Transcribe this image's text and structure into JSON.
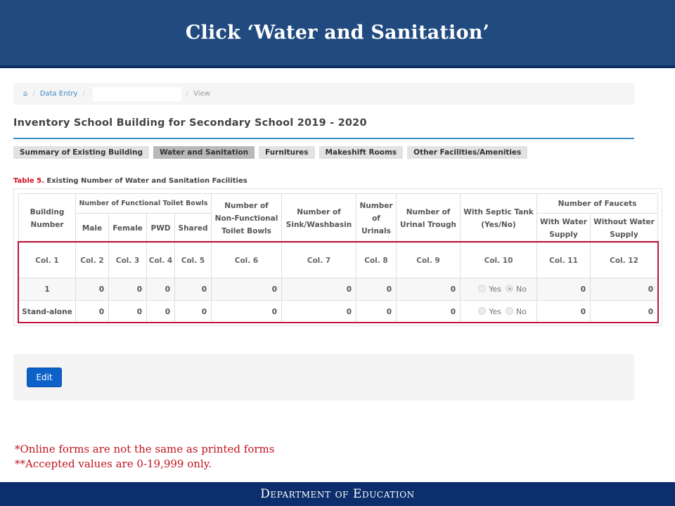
{
  "banner": {
    "title": "Click ‘Water and Sanitation’"
  },
  "breadcrumb": {
    "home_icon": "⌂",
    "separator": "/",
    "items": [
      "Data Entry",
      "",
      "View"
    ]
  },
  "page": {
    "title": "Inventory School Building for Secondary School 2019 - 2020"
  },
  "tabs": [
    {
      "label": "Summary of Existing Building",
      "active": false
    },
    {
      "label": "Water and Sanitation",
      "active": true
    },
    {
      "label": "Furnitures",
      "active": false
    },
    {
      "label": "Makeshift Rooms",
      "active": false
    },
    {
      "label": "Other Facilities/Amenities",
      "active": false
    }
  ],
  "table": {
    "caption_label": "Table 5.",
    "caption_text": "Existing Number of Water and Sanitation Facilities",
    "headers": {
      "building_number": "Building Number",
      "functional_toilets": "Number of Functional Toilet Bowls",
      "male": "Male",
      "female": "Female",
      "pwd": "PWD",
      "shared": "Shared",
      "non_functional": "Number of Non-Functional Toilet Bowls",
      "sink": "Number of Sink/Washbasin",
      "urinals": "Number of Urinals",
      "urinal_trough": "Number of Urinal Trough",
      "septic_tank": "With Septic Tank (Yes/No)",
      "faucets": "Number of Faucets",
      "with_water": "With Water Supply",
      "without_water": "Without Water Supply"
    },
    "col_numbers": [
      "Col. 1",
      "Col. 2",
      "Col. 3",
      "Col. 4",
      "Col. 5",
      "Col. 6",
      "Col. 7",
      "Col. 8",
      "Col. 9",
      "Col. 10",
      "Col. 11",
      "Col. 12"
    ],
    "radio_labels": {
      "yes": "Yes",
      "no": "No"
    },
    "rows": [
      {
        "building": "1",
        "male": "0",
        "female": "0",
        "pwd": "0",
        "shared": "0",
        "non_functional": "0",
        "sink": "0",
        "urinals": "0",
        "urinal_trough": "0",
        "septic_tank": "No",
        "with_water": "0",
        "without_water": "0"
      },
      {
        "building": "Stand-alone",
        "male": "0",
        "female": "0",
        "pwd": "0",
        "shared": "0",
        "non_functional": "0",
        "sink": "0",
        "urinals": "0",
        "urinal_trough": "0",
        "septic_tank": "",
        "with_water": "0",
        "without_water": "0"
      }
    ]
  },
  "actions": {
    "edit_label": "Edit",
    "edit_color": "#0d61c9"
  },
  "notes": [
    "*Online forms are not the same as printed forms",
    "**Accepted values are 0-19,999 only."
  ],
  "footer": {
    "text": "Department of Education"
  },
  "colors": {
    "banner": "#214b80",
    "highlight": "#c0143c",
    "note_text": "#c0141e",
    "footer": "#0c2e6c"
  }
}
